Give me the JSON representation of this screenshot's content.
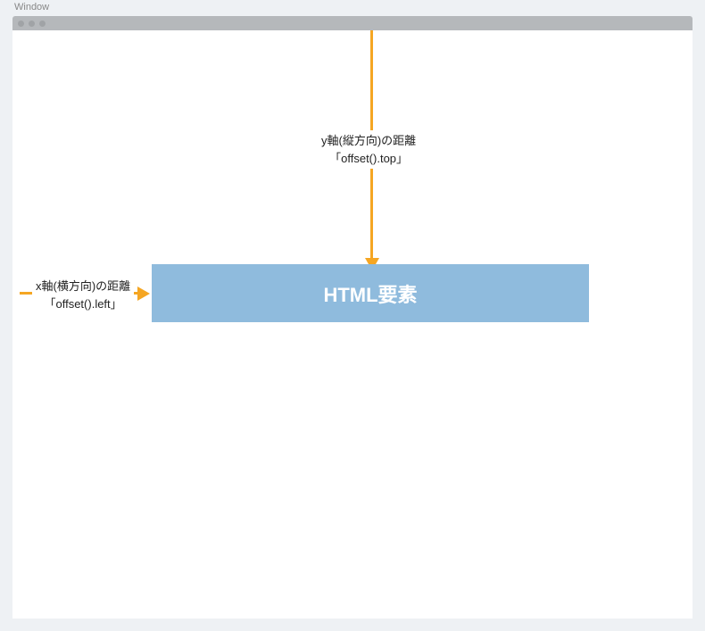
{
  "window": {
    "label": "Window"
  },
  "yAxis": {
    "label_line1": "y軸(縦方向)の距離",
    "label_line2": "「offset().top」"
  },
  "xAxis": {
    "label_line1": "x軸(横方向)の距離",
    "label_line2": "「offset().left」"
  },
  "element": {
    "label": "HTML要素"
  }
}
